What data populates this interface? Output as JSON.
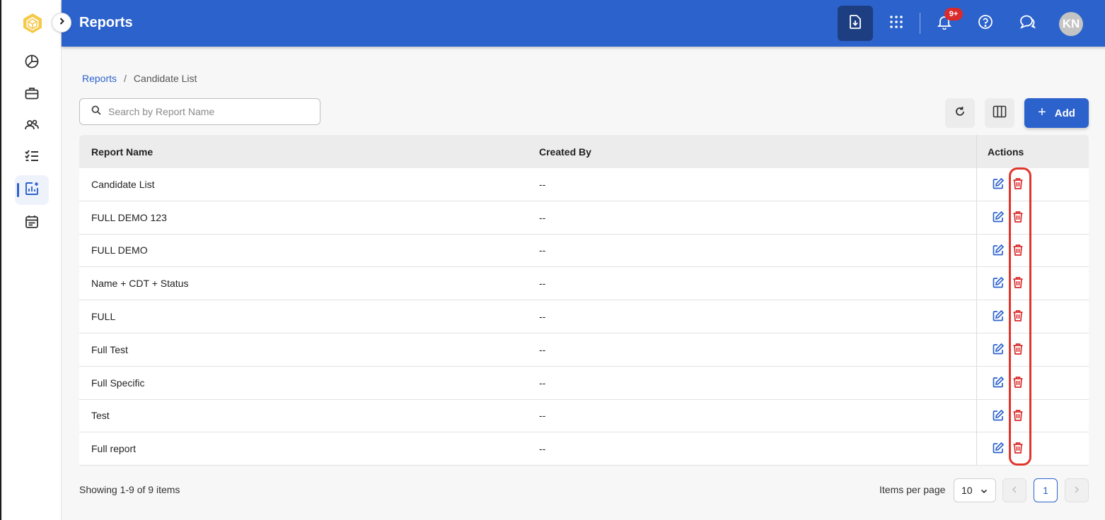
{
  "header": {
    "title": "Reports",
    "notification_badge": "9+",
    "avatar_initials": "KN"
  },
  "sidebar": {
    "items": [
      {
        "name": "dashboard",
        "icon": "pie-chart-icon",
        "active": false
      },
      {
        "name": "jobs",
        "icon": "briefcase-icon",
        "active": false
      },
      {
        "name": "candidates",
        "icon": "users-icon",
        "active": false
      },
      {
        "name": "tasks",
        "icon": "checklist-icon",
        "active": false
      },
      {
        "name": "reports",
        "icon": "chart-add-icon",
        "active": true
      },
      {
        "name": "calendar",
        "icon": "calendar-icon",
        "active": false
      }
    ]
  },
  "breadcrumb": {
    "parent": "Reports",
    "separator": "/",
    "current": "Candidate List"
  },
  "search": {
    "placeholder": "Search by Report Name",
    "value": ""
  },
  "toolbar": {
    "add_label": "Add"
  },
  "table": {
    "columns": [
      "Report Name",
      "Created By",
      "Actions"
    ],
    "rows": [
      {
        "name": "Candidate List",
        "created_by": "--"
      },
      {
        "name": "FULL DEMO 123",
        "created_by": "--"
      },
      {
        "name": "FULL DEMO",
        "created_by": "--"
      },
      {
        "name": "Name + CDT + Status",
        "created_by": "--"
      },
      {
        "name": "FULL",
        "created_by": "--"
      },
      {
        "name": "Full Test",
        "created_by": "--"
      },
      {
        "name": "Full Specific",
        "created_by": "--"
      },
      {
        "name": "Test",
        "created_by": "--"
      },
      {
        "name": "Full report",
        "created_by": "--"
      }
    ]
  },
  "footer": {
    "showing": "Showing 1-9 of 9 items",
    "items_per_page_label": "Items per page",
    "items_per_page_value": "10",
    "current_page": "1"
  },
  "colors": {
    "primary": "#2c62cc",
    "header_dark": "#1d3f82",
    "danger": "#d92b2b",
    "highlight": "#e0352b"
  }
}
